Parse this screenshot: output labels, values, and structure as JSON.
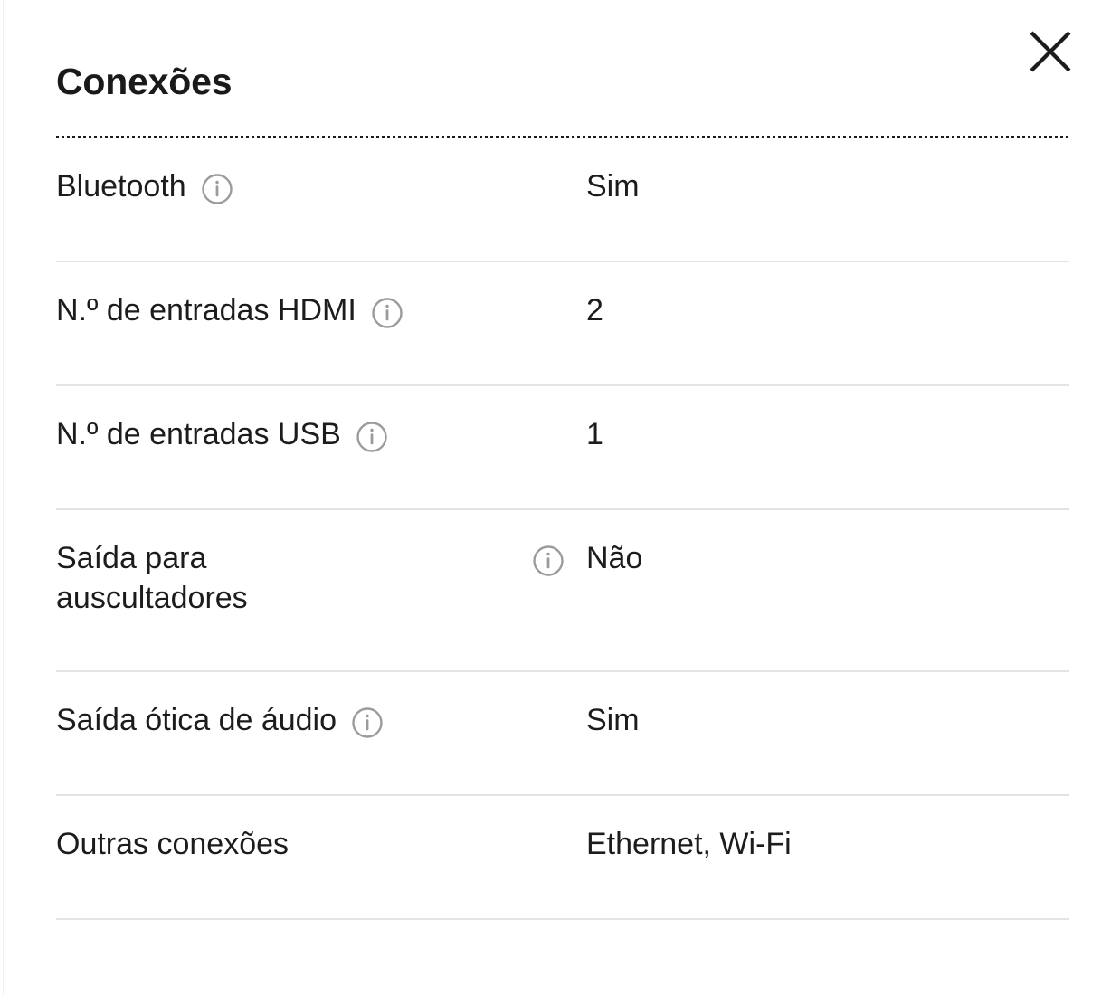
{
  "panel": {
    "title": "Conexões",
    "close_label": "×",
    "close_icon": "close-icon"
  },
  "table": {
    "rows": [
      {
        "label": "Bluetooth",
        "value": "Sim",
        "has_info_icon": true,
        "info_icon": "info-icon",
        "icon_position": "inline",
        "wraps": false
      },
      {
        "label": "N.º de entradas HDMI",
        "value": "2",
        "has_info_icon": true,
        "info_icon": "info-icon",
        "icon_position": "inline",
        "wraps": false
      },
      {
        "label": "N.º de entradas USB",
        "value": "1",
        "has_info_icon": true,
        "info_icon": "info-icon",
        "icon_position": "inline",
        "wraps": false
      },
      {
        "label": "Saída para auscultadores",
        "value": "Não",
        "has_info_icon": true,
        "info_icon": "info-icon",
        "icon_position": "end",
        "wraps": true
      },
      {
        "label": "Saída ótica de áudio",
        "value": "Sim",
        "has_info_icon": true,
        "info_icon": "info-icon",
        "icon_position": "inline",
        "wraps": false
      },
      {
        "label": "Outras conexões",
        "value": "Ethernet, Wi-Fi",
        "has_info_icon": false,
        "info_icon": "",
        "icon_position": "none",
        "wraps": false
      }
    ]
  },
  "colors": {
    "background": "#ffffff",
    "text": "#1c1c1c",
    "title": "#1a1a1a",
    "separator": "#e3e3e3",
    "dotted_separator": "#1c1c1c",
    "info_icon": "#9b9b9b"
  }
}
